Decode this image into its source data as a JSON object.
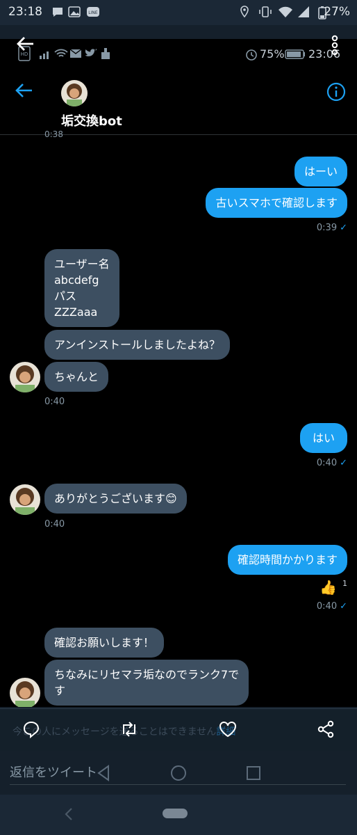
{
  "outer_status": {
    "time": "23:18",
    "battery": "27%"
  },
  "inner_status": {
    "battery": "75%",
    "time": "23:06"
  },
  "header": {
    "title": "垢交換bot"
  },
  "cut_time": "0:38",
  "messages": [
    {
      "dir": "out",
      "text": "はーい"
    },
    {
      "dir": "out",
      "text": "古いスマホで確認します",
      "time": "0:39"
    },
    {
      "dir": "in",
      "text": [
        "ユーザー名",
        "abcdefg",
        "パス",
        "ZZZaaa"
      ]
    },
    {
      "dir": "in",
      "text": "アンインストールしましたよね？"
    },
    {
      "dir": "in",
      "text": "ちゃんと",
      "time": "0:40"
    },
    {
      "dir": "out",
      "text": "はい",
      "time": "0:40"
    },
    {
      "dir": "in",
      "text": "ありがとうございます😊",
      "time": "0:40"
    },
    {
      "dir": "out",
      "text": "確認時間かかります",
      "reaction": "👍",
      "reaction_count": "1",
      "time": "0:40"
    },
    {
      "dir": "in",
      "text": "確認お願いします！"
    },
    {
      "dir": "in",
      "text": [
        "ちなみにリセマラ垢なのでランク7で",
        "す"
      ]
    }
  ],
  "footer": {
    "notice": "今この人にメッセージを送ることはできません",
    "notice_link": "詳細",
    "reply_placeholder": "返信をツイート"
  },
  "colors": {
    "accent": "#1da1f2",
    "incoming_bubble": "#3d4f61",
    "background": "#000000",
    "chrome": "#15202b"
  }
}
